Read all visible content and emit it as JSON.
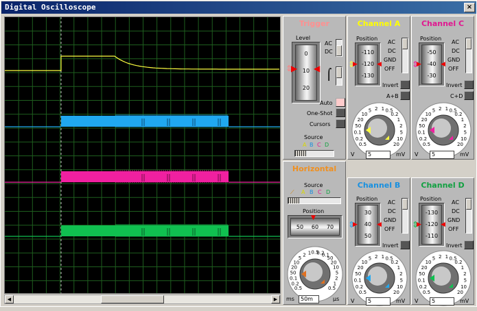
{
  "window": {
    "title": "Digital Oscilloscope",
    "close": "×"
  },
  "colors": {
    "a": "#ffff40",
    "b": "#20a8f0",
    "c": "#f020a0",
    "d": "#10c050",
    "grid": "#1e5e1e",
    "trigger_title": "#ff9090",
    "horizontal_title": "#f09020"
  },
  "trigger": {
    "title": "Trigger",
    "level_label": "Level",
    "level_ticks": [
      "0",
      "10",
      "20"
    ],
    "coupling": [
      "AC",
      "DC"
    ],
    "modes": [
      "Auto",
      "One-Shot",
      "Cursors"
    ],
    "source_label": "Source",
    "sources": [
      "A",
      "B",
      "C",
      "D"
    ]
  },
  "horizontal": {
    "title": "Horizontal",
    "source_label": "Source",
    "sources": [
      "A",
      "B",
      "C",
      "D"
    ],
    "position_label": "Position",
    "position_ticks": [
      "50",
      "60",
      "70"
    ],
    "dial_ticks": [
      "0.5",
      "0.2",
      "0.1",
      "50",
      "20",
      "10",
      "5",
      "2",
      "1",
      "0.5",
      "0.2",
      "0.1",
      "50",
      "20",
      "10",
      "5",
      "2",
      "1",
      "0.5"
    ],
    "unit_left": "ms",
    "unit_value": "50m",
    "unit_right": "µs"
  },
  "channels": [
    {
      "id": "a",
      "title": "Channel A",
      "position_label": "Position",
      "ticks": [
        "-110",
        "-120",
        "-130"
      ],
      "coupling": [
        "AC",
        "DC",
        "GND",
        "OFF"
      ],
      "invert": "Invert",
      "combine": "A+B",
      "unit_left": "V",
      "unit_value": "5",
      "unit_right": "mV",
      "dial_ticks": [
        "0.5",
        "0.2",
        "0.1",
        "50",
        "20",
        "10",
        "5",
        "2",
        "1",
        "0.5",
        "0.2",
        "1",
        "2",
        "5",
        "10",
        "20"
      ]
    },
    {
      "id": "c",
      "title": "Channel C",
      "position_label": "Position",
      "ticks": [
        "-50",
        "-40",
        "-30"
      ],
      "coupling": [
        "AC",
        "DC",
        "GND",
        "OFF"
      ],
      "invert": "Invert",
      "combine": "C+D",
      "unit_left": "V",
      "unit_value": "5",
      "unit_right": "mV",
      "dial_ticks": [
        "0.5",
        "0.2",
        "0.1",
        "50",
        "20",
        "10",
        "5",
        "2",
        "1",
        "0.5",
        "0.2",
        "1",
        "2",
        "5",
        "10",
        "20"
      ]
    },
    {
      "id": "b",
      "title": "Channel B",
      "position_label": "Position",
      "ticks": [
        "30",
        "40",
        "50"
      ],
      "coupling": [
        "AC",
        "DC",
        "GND",
        "OFF"
      ],
      "invert": "Invert",
      "combine": "",
      "unit_left": "V",
      "unit_value": "5",
      "unit_right": "mV",
      "dial_ticks": [
        "0.5",
        "0.2",
        "0.1",
        "50",
        "20",
        "10",
        "5",
        "2",
        "1",
        "0.5",
        "0.2",
        "1",
        "2",
        "5",
        "10",
        "20"
      ]
    },
    {
      "id": "d",
      "title": "Channel D",
      "position_label": "Position",
      "ticks": [
        "-130",
        "-120",
        "-110"
      ],
      "coupling": [
        "AC",
        "DC",
        "GND",
        "OFF"
      ],
      "invert": "Invert",
      "combine": "",
      "unit_left": "V",
      "unit_value": "5",
      "unit_right": "mV",
      "dial_ticks": [
        "0.5",
        "0.2",
        "0.1",
        "50",
        "20",
        "10",
        "5",
        "2",
        "1",
        "0.5",
        "0.2",
        "1",
        "2",
        "5",
        "10",
        "20"
      ]
    }
  ]
}
